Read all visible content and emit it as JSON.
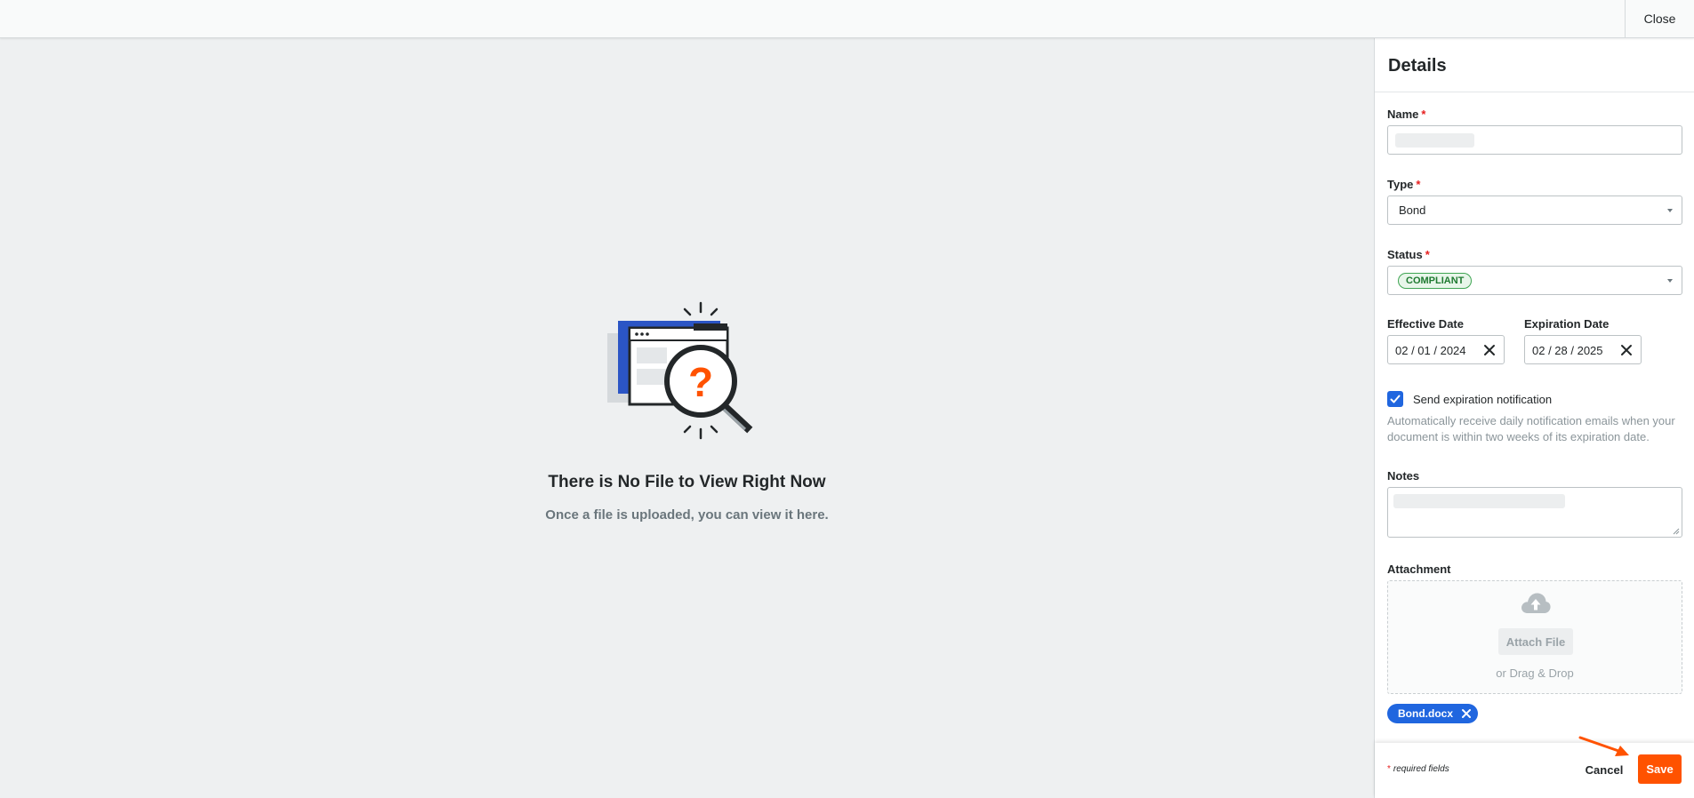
{
  "topbar": {
    "close_label": "Close"
  },
  "viewer": {
    "empty_title": "There is No File to View Right Now",
    "empty_subtitle": "Once a file is uploaded, you can view it here."
  },
  "panel": {
    "title": "Details",
    "name": {
      "label": "Name",
      "required_mark": "*",
      "value": ""
    },
    "type": {
      "label": "Type",
      "required_mark": "*",
      "value": "Bond"
    },
    "status": {
      "label": "Status",
      "required_mark": "*",
      "value": "COMPLIANT"
    },
    "effective_date": {
      "label": "Effective Date",
      "value": "02 / 01 / 2024"
    },
    "expiration_date": {
      "label": "Expiration Date",
      "value": "02 / 28 / 2025"
    },
    "notification": {
      "label": "Send expiration notification",
      "checked": true,
      "help": "Automatically receive daily notification emails when your document is within two weeks of its expiration date."
    },
    "notes": {
      "label": "Notes",
      "value": ""
    },
    "attachment": {
      "label": "Attachment",
      "button_label": "Attach File",
      "drag_text": "or Drag & Drop",
      "files": [
        "Bond.docx"
      ]
    },
    "footer": {
      "required_star": "*",
      "required_note": "required fields",
      "cancel_label": "Cancel",
      "save_label": "Save"
    }
  },
  "colors": {
    "accent_orange": "#ff5200",
    "accent_blue": "#2066df",
    "status_green": "#1f7a31"
  }
}
